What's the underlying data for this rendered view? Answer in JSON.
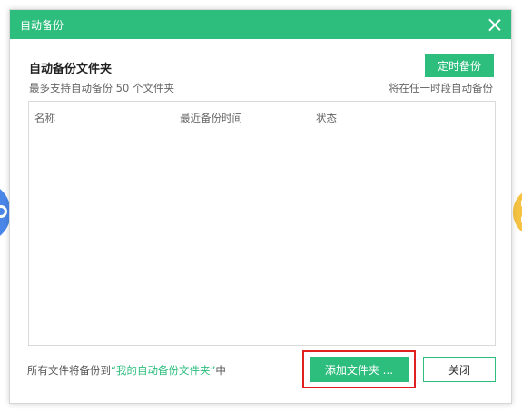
{
  "dialog": {
    "title": "自动备份",
    "heading": "自动备份文件夹",
    "timer_button": "定时备份",
    "subtext_left": "最多支持自动备份 50 个文件夹",
    "subtext_right": "将在任一时段自动备份"
  },
  "table": {
    "columns": [
      "名称",
      "最近备份时间",
      "状态"
    ],
    "rows": []
  },
  "footer": {
    "note_prefix": "所有文件将备份到",
    "note_link": "“我的自动备份文件夹”",
    "note_suffix": "中",
    "add_button": "添加文件夹 ...",
    "close_button": "关闭"
  },
  "colors": {
    "accent": "#2dbd7d",
    "highlight": "#e02020"
  },
  "icons": {
    "close": "close-icon"
  }
}
